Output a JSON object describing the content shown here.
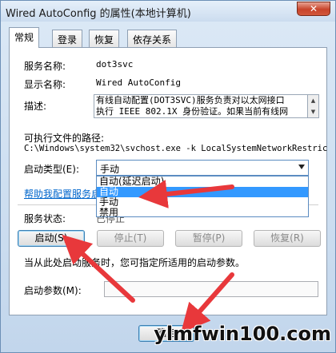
{
  "window": {
    "title": "Wired AutoConfig 的属性(本地计算机)",
    "close_glyph": "✕"
  },
  "tabs": [
    {
      "label": "常规",
      "active": true
    },
    {
      "label": "登录",
      "active": false
    },
    {
      "label": "恢复",
      "active": false
    },
    {
      "label": "依存关系",
      "active": false
    }
  ],
  "general": {
    "service_name_label": "服务名称:",
    "service_name_value": "dot3svc",
    "display_name_label": "显示名称:",
    "display_name_value": "Wired AutoConfig",
    "description_label": "描述:",
    "description_line1": "有线自动配置(DOT3SVC)服务负责对以太网接口",
    "description_line2": "执行 IEEE 802.1X 身份验证。如果当前有线网",
    "exec_path_label": "可执行文件的路径:",
    "exec_path_value": "C:\\Windows\\system32\\svchost.exe -k LocalSystemNetworkRestric",
    "startup_type_label": "启动类型(E):",
    "startup_type_value": "手动",
    "startup_options": [
      "自动(延迟启动)",
      "自动",
      "手动",
      "禁用"
    ],
    "selected_option_index": 1,
    "help_link": "帮助我配置服务启",
    "status_label": "服务状态:",
    "status_value": "已停止",
    "buttons": {
      "start": "启动(S)",
      "stop": "停止(T)",
      "pause": "暂停(P)",
      "resume": "恢复(R)"
    },
    "hint_text": "当从此处启动服务时，您可指定所适用的启动参数。",
    "start_params_label": "启动参数(M):",
    "start_params_value": ""
  },
  "footer": {
    "ok_label": "确定"
  },
  "watermark": "ylmfwin100.com",
  "colors": {
    "annotation_arrow": "#e8383b",
    "selection": "#3399ff",
    "link": "#0066cc"
  }
}
